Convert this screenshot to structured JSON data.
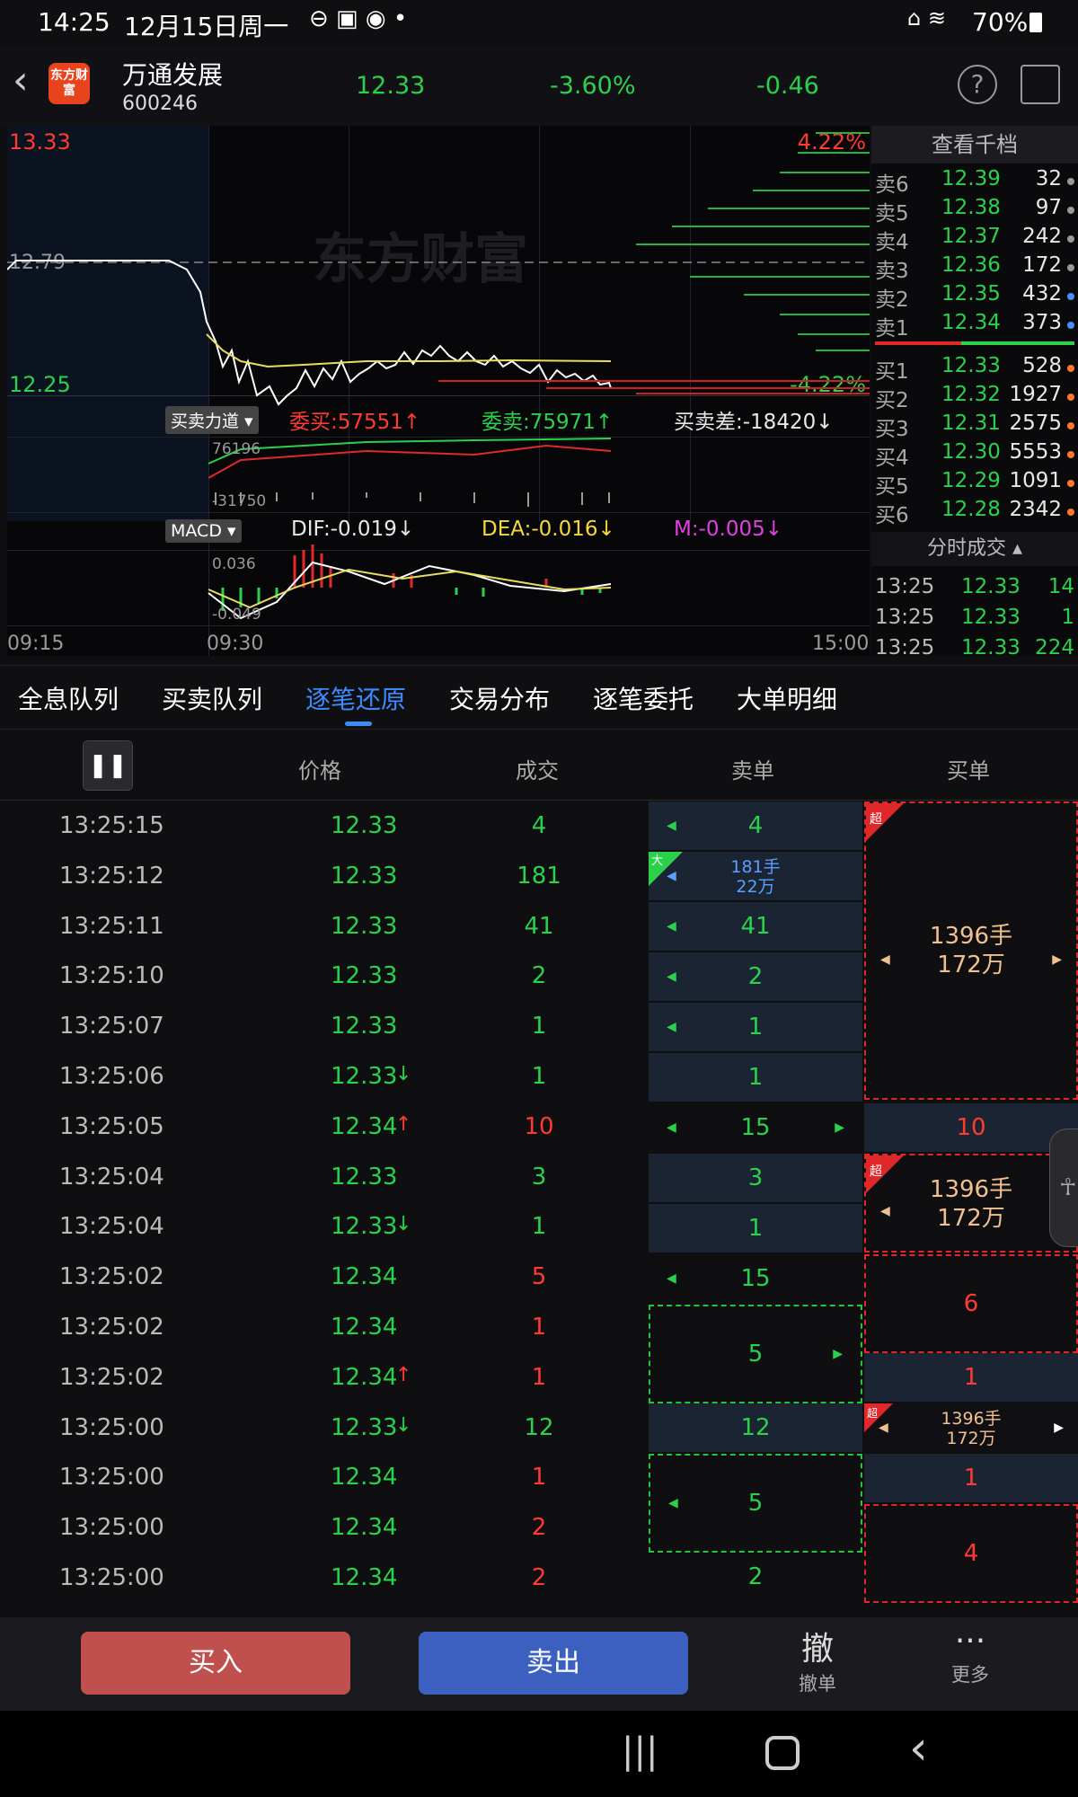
{
  "status_bar": {
    "time": "14:25",
    "date": "12月15日周一",
    "battery": "70%"
  },
  "header": {
    "logo": "东方财富",
    "stock_name": "万通发展",
    "stock_code": "600246",
    "price": "12.33",
    "change_pct": "-3.60%",
    "change": "-0.46"
  },
  "chart": {
    "price_high": "13.33",
    "price_low": "12.25",
    "pct_high": "4.22%",
    "pct_low": "-4.22%",
    "prev_close": "12.79",
    "watermark": "东方财富",
    "indicator1": {
      "name": "买卖力道",
      "buy": "委买:57551↑",
      "sell": "委卖:75971↑",
      "diff": "买卖差:-18420↓",
      "upper": "76196",
      "lower": "-31750"
    },
    "indicator2": {
      "name": "MACD",
      "dif": "DIF:-0.019↓",
      "dea": "DEA:-0.016↓",
      "m": "M:-0.005↓",
      "upper": "0.036",
      "lower": "-0.049"
    },
    "time_start": "09:15",
    "time_open": "09:30",
    "time_end": "15:00"
  },
  "order_book": {
    "title": "查看千档",
    "asks": [
      {
        "label": "卖6",
        "price": "12.39",
        "vol": "32"
      },
      {
        "label": "卖5",
        "price": "12.38",
        "vol": "97"
      },
      {
        "label": "卖4",
        "price": "12.37",
        "vol": "242"
      },
      {
        "label": "卖3",
        "price": "12.36",
        "vol": "172"
      },
      {
        "label": "卖2",
        "price": "12.35",
        "vol": "432"
      },
      {
        "label": "卖1",
        "price": "12.34",
        "vol": "373"
      }
    ],
    "bids": [
      {
        "label": "买1",
        "price": "12.33",
        "vol": "528"
      },
      {
        "label": "买2",
        "price": "12.32",
        "vol": "1927"
      },
      {
        "label": "买3",
        "price": "12.31",
        "vol": "2575"
      },
      {
        "label": "买4",
        "price": "12.30",
        "vol": "5553"
      },
      {
        "label": "买5",
        "price": "12.29",
        "vol": "1091"
      },
      {
        "label": "买6",
        "price": "12.28",
        "vol": "2342"
      }
    ],
    "ticks_title": "分时成交",
    "ticks": [
      {
        "time": "13:25",
        "price": "12.33",
        "vol": "14"
      },
      {
        "time": "13:25",
        "price": "12.33",
        "vol": "1"
      },
      {
        "time": "13:25",
        "price": "12.33",
        "vol": "224"
      }
    ]
  },
  "tabs": [
    "全息队列",
    "买卖队列",
    "逐笔还原",
    "交易分布",
    "逐笔委托",
    "大单明细"
  ],
  "table": {
    "headers": {
      "price": "价格",
      "volume": "成交",
      "sell": "卖单",
      "buy": "买单"
    },
    "rows": [
      {
        "time": "13:25:15",
        "price": "12.33",
        "vol": "4",
        "arrow": ""
      },
      {
        "time": "13:25:12",
        "price": "12.33",
        "vol": "181",
        "arrow": ""
      },
      {
        "time": "13:25:11",
        "price": "12.33",
        "vol": "41",
        "arrow": ""
      },
      {
        "time": "13:25:10",
        "price": "12.33",
        "vol": "2",
        "arrow": ""
      },
      {
        "time": "13:25:07",
        "price": "12.33",
        "vol": "1",
        "arrow": ""
      },
      {
        "time": "13:25:06",
        "price": "12.33",
        "vol": "1",
        "arrow": "↓"
      },
      {
        "time": "13:25:05",
        "price": "12.34",
        "vol": "10",
        "arrow": "↑"
      },
      {
        "time": "13:25:04",
        "price": "12.33",
        "vol": "3",
        "arrow": ""
      },
      {
        "time": "13:25:04",
        "price": "12.33",
        "vol": "1",
        "arrow": "↓"
      },
      {
        "time": "13:25:02",
        "price": "12.34",
        "vol": "5",
        "arrow": ""
      },
      {
        "time": "13:25:02",
        "price": "12.34",
        "vol": "1",
        "arrow": ""
      },
      {
        "time": "13:25:02",
        "price": "12.34",
        "vol": "1",
        "arrow": "↑"
      },
      {
        "time": "13:25:00",
        "price": "12.33",
        "vol": "12",
        "arrow": "↓"
      },
      {
        "time": "13:25:00",
        "price": "12.34",
        "vol": "1",
        "arrow": ""
      },
      {
        "time": "13:25:00",
        "price": "12.34",
        "vol": "2",
        "arrow": ""
      },
      {
        "time": "13:25:00",
        "price": "12.34",
        "vol": "2",
        "arrow": ""
      }
    ],
    "sell_cells": {
      "c1": "4",
      "c2a": "181手",
      "c2b": "22万",
      "c3": "41",
      "c4": "2",
      "c5": "1",
      "c6": "1",
      "c7": "15",
      "c8": "3",
      "c9": "1",
      "c10": "15",
      "c11": "5",
      "c12": "12",
      "c13": "5",
      "c14": "2"
    },
    "buy_cells": {
      "b1a": "1396手",
      "b1b": "172万",
      "b2": "10",
      "b3a": "1396手",
      "b3b": "172万",
      "b4": "6",
      "b5": "1",
      "b6a": "1396手",
      "b6b": "172万",
      "b7": "1",
      "b8": "4"
    },
    "badges": {
      "chao": "超",
      "da": "大"
    }
  },
  "bottom_bar": {
    "buy": "买入",
    "sell": "卖出",
    "cancel_icon": "撤",
    "cancel": "撤单",
    "more": "更多"
  }
}
